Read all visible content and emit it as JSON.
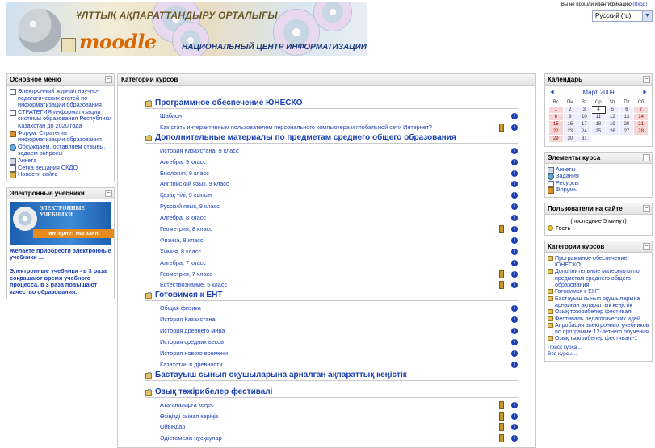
{
  "header": {
    "banner_top": "ҰЛТТЫҚ АҚПАРАТТАНДЫРУ ОРТАЛЫҒЫ",
    "logo_text": "moodle",
    "banner_bottom": "НАЦИОНАЛЬНЫЙ ЦЕНТР ИНФОРМАТИЗАЦИИ",
    "login_text": "Вы не прошли идентификацию",
    "login_link": "(Вход)",
    "language_selected": "Русский (ru)"
  },
  "left": {
    "main_menu": {
      "title": "Основное меню",
      "items": [
        {
          "label": "Электронный журнал научно-педагогических статей по информатизации образования",
          "icon": "document-icon"
        },
        {
          "label": "СТРАТЕГИЯ информатизации системы образования Республики Казахстан до 2020 года",
          "icon": "document-icon"
        },
        {
          "label": "Форум. Стратегия информатизации образования",
          "icon": "forum-icon"
        },
        {
          "label": "Обсуждаем, оставляем отзывы, задаем вопросы",
          "icon": "chat-icon"
        },
        {
          "label": "Анкета",
          "icon": "questionnaire-icon"
        },
        {
          "label": "Сетка вещания СКДО",
          "icon": "document-icon"
        },
        {
          "label": "Новости сайта",
          "icon": "news-icon"
        }
      ]
    },
    "ebooks": {
      "title": "Электронные учебники",
      "banner_top": "ЭЛЕКТРОННЫЕ УЧЕБНИКИ",
      "banner_bottom": "интернет магазин",
      "link": "Желаете приобрести электронные учебники ...",
      "text": "Электронные учебники - в 3 раза сокращают время учебного процесса, в 3 раза повышают качество образования."
    }
  },
  "center": {
    "title": "Категории курсов",
    "categories": [
      {
        "name": "Программное обеспечение ЮНЕСКО",
        "courses": [
          {
            "name": "Шаблон",
            "guest": false
          },
          {
            "name": "Как стать интерактивным пользователем персонального компьютера и глобальной сети Интернет?",
            "guest": true
          }
        ]
      },
      {
        "name": "Дополнительные материалы по предметам среднего общего образования",
        "courses": [
          {
            "name": "История Казахстана, 9 класс",
            "guest": false
          },
          {
            "name": "Алгебра, 9 класс",
            "guest": false
          },
          {
            "name": "Биология, 9 класс",
            "guest": false
          },
          {
            "name": "Английский язык, 9 класс",
            "guest": false
          },
          {
            "name": "Қазақ тілі, 9 сынып",
            "guest": false
          },
          {
            "name": "Русский язык, 9 класс",
            "guest": false
          },
          {
            "name": "Алгебра, 8 класс",
            "guest": false
          },
          {
            "name": "Геометрия, 8 класс",
            "guest": true
          },
          {
            "name": "Физика, 8 класс",
            "guest": false
          },
          {
            "name": "Химия, 8 класс",
            "guest": false
          },
          {
            "name": "Алгебра, 7 класс",
            "guest": false
          },
          {
            "name": "Геометрия, 7 класс",
            "guest": true
          },
          {
            "name": "Естествознание, 5 класс",
            "guest": true
          }
        ]
      },
      {
        "name": "Готовимся к ЕНТ",
        "courses": [
          {
            "name": "Общая физика",
            "guest": false
          },
          {
            "name": "История Казахстана",
            "guest": false
          },
          {
            "name": "История древнего мира",
            "guest": false
          },
          {
            "name": "История средних веков",
            "guest": false
          },
          {
            "name": "История нового времени",
            "guest": false
          },
          {
            "name": "Казахстан в древности",
            "guest": false
          }
        ]
      },
      {
        "name": "Бастауыш сынып оқушыларына арналған ақпараттық кеңістік",
        "courses": []
      },
      {
        "name": "Озық тәжірибелер фестивалі",
        "courses": [
          {
            "name": "Ата-аналарға кеңес",
            "guest": true
          },
          {
            "name": "Өзіңізді сынап көріңіз",
            "guest": true
          },
          {
            "name": "Ойындар",
            "guest": true
          },
          {
            "name": "Әдістемелік нұсқаулар",
            "guest": true
          }
        ]
      }
    ]
  },
  "right": {
    "calendar": {
      "title": "Календарь",
      "month": "Март 2009",
      "weekdays": [
        "Вс",
        "Пн",
        "Вт",
        "Ср",
        "Чт",
        "Пт",
        "Сб"
      ],
      "weeks": [
        [
          "1",
          "2",
          "3",
          "4",
          "5",
          "6",
          "7"
        ],
        [
          "8",
          "9",
          "10",
          "11",
          "12",
          "13",
          "14"
        ],
        [
          "15",
          "16",
          "17",
          "18",
          "19",
          "20",
          "21"
        ],
        [
          "22",
          "23",
          "24",
          "25",
          "26",
          "27",
          "28"
        ],
        [
          "29",
          "30",
          "31",
          "",
          "",
          "",
          ""
        ]
      ],
      "today": "4"
    },
    "course_elements": {
      "title": "Элементы курса",
      "items": [
        {
          "label": "Анкеты",
          "icon": "questionnaire-icon"
        },
        {
          "label": "Задания",
          "icon": "assignment-icon"
        },
        {
          "label": "Ресурсы",
          "icon": "resource-icon"
        },
        {
          "label": "Форумы",
          "icon": "forum-icon"
        }
      ]
    },
    "users": {
      "title": "Пользователи на сайте",
      "note": "(последние 5 минут)",
      "user": "Гость"
    },
    "categories": {
      "title": "Категории курсов",
      "items": [
        "Программное обеспечение ЮНЕСКО",
        "Дополнительные материалы по предметам среднего общего образования",
        "Готовимся к ЕНТ",
        "Бастауыш сынып оқушыларына арналған ақпараттық кеңістік",
        "Озық тәжірибелер фестивалі",
        "Фестиваль педагогических идей",
        "Апробация электронных учебников по программе 12-летнего обучения",
        "Озық тәжірибелер фестивалі-1"
      ],
      "search_link": "Поиск курса ...",
      "all_courses_link": "Все курсы ..."
    }
  }
}
